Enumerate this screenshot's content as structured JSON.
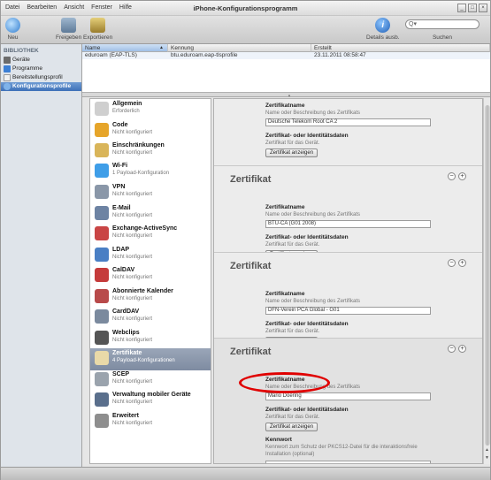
{
  "window": {
    "title": "iPhone-Konfigurationsprogramm",
    "buttons": [
      "_",
      "□",
      "×"
    ]
  },
  "menu": [
    "Datei",
    "Bearbeiten",
    "Ansicht",
    "Fenster",
    "Hilfe"
  ],
  "toolbar": {
    "new": "Neu",
    "share": "Freigeben",
    "export": "Exportieren",
    "details": "Details ausb.",
    "search_label": "Suchen",
    "search_value": ""
  },
  "sidebar": {
    "heading": "BIBLIOTHEK",
    "items": [
      {
        "label": "Geräte",
        "icon": "device-icon",
        "color": "#6b6b6b"
      },
      {
        "label": "Programme",
        "icon": "apps-icon",
        "color": "#3c7fd4"
      },
      {
        "label": "Bereitstellungsprofil",
        "icon": "provisioning-icon",
        "color": "#f0f0f0"
      },
      {
        "label": "Konfigurationsprofile",
        "icon": "config-profile-icon",
        "color": "#7fb3ea"
      }
    ]
  },
  "profile_list": {
    "columns": [
      "Name",
      "Kennung",
      "Erstellt"
    ],
    "rows": [
      {
        "name": "eduroam (EAP-TLS)",
        "id": "btu.eduroam.eap-tlsprofile",
        "created": "23.11.2011 08:58:47"
      }
    ]
  },
  "payloads": [
    {
      "title": "Allgemein",
      "sub": "Erforderlich",
      "icon": "general-icon",
      "color": "#cfcfcf"
    },
    {
      "title": "Code",
      "sub": "Nicht konfiguriert",
      "icon": "passcode-key-icon",
      "color": "#e6a52a"
    },
    {
      "title": "Einschränkungen",
      "sub": "Nicht konfiguriert",
      "icon": "restrictions-lock-icon",
      "color": "#d9b55a"
    },
    {
      "title": "Wi-Fi",
      "sub": "1 Payload-Konfiguration",
      "icon": "wifi-icon",
      "color": "#3f9ee8"
    },
    {
      "title": "VPN",
      "sub": "Nicht konfiguriert",
      "icon": "vpn-icon",
      "color": "#8a97a8"
    },
    {
      "title": "E-Mail",
      "sub": "Nicht konfiguriert",
      "icon": "mail-icon",
      "color": "#6d83a3"
    },
    {
      "title": "Exchange-ActiveSync",
      "sub": "Nicht konfiguriert",
      "icon": "exchange-icon",
      "color": "#c94545"
    },
    {
      "title": "LDAP",
      "sub": "Nicht konfiguriert",
      "icon": "ldap-icon",
      "color": "#4a7fc4"
    },
    {
      "title": "CalDAV",
      "sub": "Nicht konfiguriert",
      "icon": "calendar-icon",
      "color": "#c53b3b"
    },
    {
      "title": "Abonnierte Kalender",
      "sub": "Nicht konfiguriert",
      "icon": "subscribed-calendar-icon",
      "color": "#b84a4a"
    },
    {
      "title": "CardDAV",
      "sub": "Nicht konfiguriert",
      "icon": "contacts-icon",
      "color": "#7b8a9e"
    },
    {
      "title": "Webclips",
      "sub": "Nicht konfiguriert",
      "icon": "webclip-icon",
      "color": "#555555"
    },
    {
      "title": "Zertifikate",
      "sub": "4 Payload-Konfigurationen",
      "icon": "certificate-icon",
      "color": "#e9d9a8"
    },
    {
      "title": "SCEP",
      "sub": "Nicht konfiguriert",
      "icon": "scep-icon",
      "color": "#9aa3ad"
    },
    {
      "title": "Verwaltung mobiler Geräte",
      "sub": "Nicht konfiguriert",
      "icon": "mdm-icon",
      "color": "#5a6f8c"
    },
    {
      "title": "Erweitert",
      "sub": "Nicht konfiguriert",
      "icon": "advanced-gear-icon",
      "color": "#8e8e8e"
    }
  ],
  "cert_labels": {
    "section_title": "Zertifikat",
    "name_label": "Zertifikatname",
    "name_help": "Name oder Beschreibung des Zertifikats",
    "data_label": "Zertifikat- oder Identitätsdaten",
    "data_help": "Zertifikat für das Gerät.",
    "show_button": "Zertifikat anzeigen",
    "password_label": "Kennwort",
    "password_help_1": "Kennwort zum Schutz der PKCS12-Datei für die interaktionsfreie",
    "password_help_2": "Installation (optional)"
  },
  "certificates": [
    {
      "name": "Deutsche Telekom Root CA 2"
    },
    {
      "name": "BTU-CA (G01 2008)"
    },
    {
      "name": "DFN-Verein PCA Global - G01"
    },
    {
      "name": "Mario Doering",
      "password": ""
    }
  ],
  "colors": {
    "annotation": "#e00000",
    "selection": "#3f71b8"
  }
}
